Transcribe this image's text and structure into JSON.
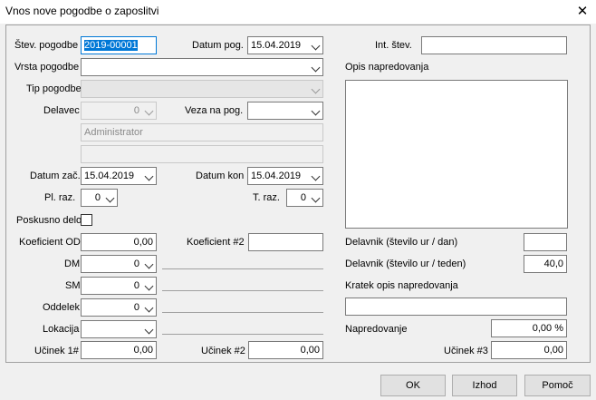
{
  "window": {
    "title": "Vnos nove pogodbe o zaposlitvi",
    "close_glyph": "✕"
  },
  "form": {
    "stev_pogodbe_label": "Štev. pogodbe",
    "stev_pogodbe_value": "2019-00001",
    "datum_pog_label": "Datum pog.",
    "datum_pog_value": "15.04.2019",
    "int_stev_label": "Int. štev.",
    "int_stev_value": "",
    "vrsta_pogodbe_label": "Vrsta pogodbe",
    "vrsta_pogodbe_value": "",
    "tip_pogodbe_label": "Tip pogodbe",
    "tip_pogodbe_value": "",
    "delavec_label": "Delavec",
    "delavec_value": "0",
    "veza_na_pog_label": "Veza na pog.",
    "veza_na_pog_value": "",
    "user_field_value": "Administrator",
    "blank_field_value": "",
    "datum_zac_label": "Datum zač.",
    "datum_zac_value": "15.04.2019",
    "datum_kon_label": "Datum kon",
    "datum_kon_value": "15.04.2019",
    "pl_raz_label": "Pl. raz.",
    "pl_raz_value": "0",
    "t_raz_label": "T. raz.",
    "t_raz_value": "0",
    "poskusno_delo_label": "Poskusno delo",
    "poskusno_delo_checked": false,
    "koeficient_od_label": "Koeficient OD",
    "koeficient_od_value": "0,00",
    "koeficient_2_label": "Koeficient #2",
    "koeficient_2_value": "",
    "dm_label": "DM",
    "dm_value": "0",
    "sm_label": "SM",
    "sm_value": "0",
    "oddelek_label": "Oddelek",
    "oddelek_value": "0",
    "lokacija_label": "Lokacija",
    "lokacija_value": "",
    "ucinek_1_label": "Učinek 1#",
    "ucinek_1_value": "0,00",
    "ucinek_2_label": "Učinek #2",
    "ucinek_2_value": "0,00",
    "opis_napredovanja_label": "Opis napredovanja",
    "opis_napredovanja_value": "",
    "delavnik_dan_label": "Delavnik (število ur / dan)",
    "delavnik_dan_value": "",
    "delavnik_teden_label": "Delavnik (število ur / teden)",
    "delavnik_teden_value": "40,0",
    "kratek_opis_label": "Kratek opis napredovanja",
    "kratek_opis_value": "",
    "napredovanje_label": "Napredovanje",
    "napredovanje_value": "0,00 %",
    "ucinek_3_label": "Učinek #3",
    "ucinek_3_value": "0,00"
  },
  "buttons": {
    "ok": "OK",
    "izhod": "Izhod",
    "pomoc": "Pomoč"
  }
}
